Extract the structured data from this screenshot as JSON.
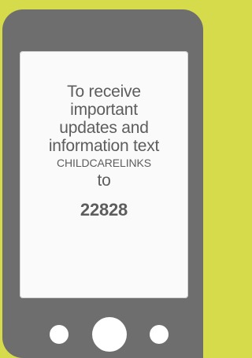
{
  "message": {
    "line1": "To receive",
    "line2": "important",
    "line3": "updates and",
    "line4": "information text",
    "keyword": "CHILDCARELINKS",
    "to": "to",
    "number": "22828"
  },
  "colors": {
    "background": "#d6db4c",
    "phone_body": "#6e6e6e",
    "screen": "#fafafa",
    "text": "#5d5d5d",
    "buttons": "#ffffff"
  }
}
